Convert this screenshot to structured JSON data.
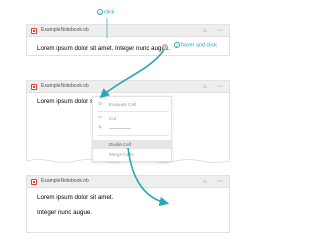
{
  "callouts": {
    "step1": {
      "num": "1",
      "text": "click"
    },
    "step2": {
      "num": "2",
      "text": "hover and click"
    }
  },
  "panel1": {
    "title": "ExampleNotebook.nb",
    "cell_text": "Lorem ipsum dolor sit amet. Integer nunc augue."
  },
  "panel2": {
    "title": "ExampleNotebook.nb",
    "cell_text": "Lorem ipsum dolor sit amet. Integer nunc augue."
  },
  "menu": {
    "items": [
      {
        "icon": "⊙",
        "label": "Evaluate Cell"
      },
      {
        "icon": "✂",
        "label": "Cut"
      },
      {
        "icon": "✎",
        "label": ""
      },
      {
        "icon": "",
        "label": "Divide Cell"
      },
      {
        "icon": "",
        "label": "Merge Cells"
      }
    ]
  },
  "panel3": {
    "title": "ExampleNotebook.nb",
    "line1": "Lorem ipsum dolor sit amet.",
    "line2": "Integer nunc augue."
  },
  "colors": {
    "accent": "#2aa7b8",
    "notebook_icon": "#e0403a"
  }
}
